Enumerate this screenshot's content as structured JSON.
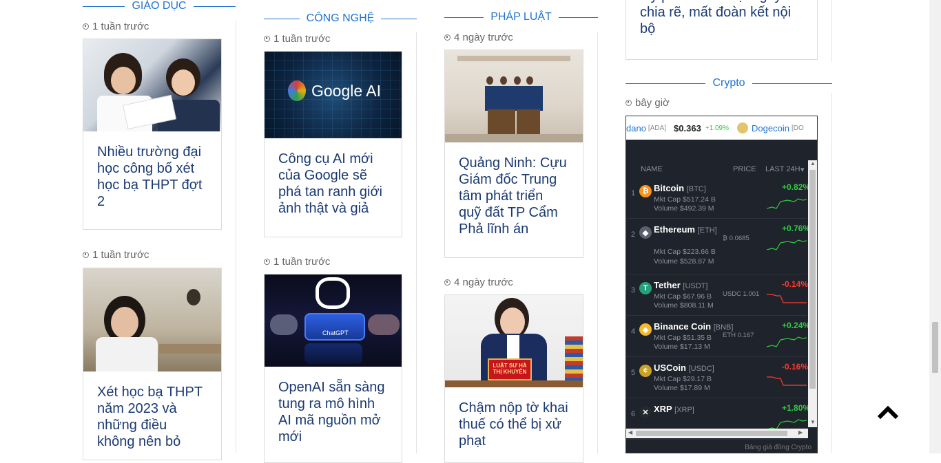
{
  "sections": {
    "giao_duc": {
      "label": "GIÁO DỤC",
      "articles": [
        {
          "time": "1 tuần trước",
          "title": "Nhiều trường đại học công bố xét học bạ THPT đợt 2"
        },
        {
          "time": "1 tuần trước",
          "title": "Xét học bạ THPT năm 2023 và những điều không nên bỏ"
        }
      ]
    },
    "cong_nghe": {
      "label": "CÔNG NGHỆ",
      "articles": [
        {
          "time": "1 tuần trước",
          "title": "Công cụ AI mới của Google sẽ phá tan ranh giới ảnh thật và giả",
          "image_text": "Google AI"
        },
        {
          "time": "1 tuần trước",
          "title": "OpenAI sẵn sàng tung ra mô hình AI mã nguồn mở mới",
          "image_text": "ChatGPT"
        }
      ]
    },
    "phap_luat": {
      "label": "PHÁP LUẬT",
      "articles": [
        {
          "time": "4 ngày trước",
          "title": "Quảng Ninh: Cựu Giám đốc Trung tâm phát triển quỹ đất TP Cẩm Phả lĩnh án"
        },
        {
          "time": "4 ngày trước",
          "title": "Chậm nộp tờ khai thuế có thể bị xử phạt",
          "image_text": "LUẬT SƯ HÀ THỊ KHUYÊN"
        }
      ]
    }
  },
  "prev_article": {
    "title": "lấy phiếu tín nhiệm gây chia rẽ, mất đoàn kết nội bộ"
  },
  "crypto": {
    "label": "Crypto",
    "time": "bây giờ",
    "ticker": [
      {
        "name": "dano",
        "sym": "[ADA]",
        "price": "$0.363",
        "change": "+1.09%"
      },
      {
        "name": "Dogecoin",
        "sym": "[DO"
      }
    ],
    "headers": {
      "name": "NAME",
      "price": "PRICE",
      "last": "LAST 24H"
    },
    "coins": [
      {
        "rank": "1",
        "name": "Bitcoin",
        "sym": "[BTC]",
        "mktcap": "Mkt Cap  $517.24 B",
        "volume": "Volume  $492.39 M",
        "price": "",
        "change": "+0.82%",
        "up": true,
        "icon": "₿",
        "color": "#f7931a"
      },
      {
        "rank": "2",
        "name": "Ethereum",
        "sym": "[ETH]",
        "mktcap": "Mkt Cap  $223.66 B",
        "volume": "Volume  $528.87 M",
        "price": "₿ 0.0685",
        "change": "+0.76%",
        "up": true,
        "icon": "◆",
        "color": "#5a6072"
      },
      {
        "rank": "3",
        "name": "Tether",
        "sym": "[USDT]",
        "mktcap": "Mkt Cap  $67.96 B",
        "volume": "Volume  $808.11 M",
        "price": "USDC 1.001",
        "change": "-0.14%",
        "up": false,
        "icon": "T",
        "color": "#26a17b"
      },
      {
        "rank": "4",
        "name": "Binance Coin",
        "sym": "[BNB]",
        "mktcap": "Mkt Cap  $51.35 B",
        "volume": "Volume  $17.13 M",
        "price": "ETH 0.167",
        "change": "+0.24%",
        "up": true,
        "icon": "◈",
        "color": "#f3ba2f"
      },
      {
        "rank": "5",
        "name": "USCoin",
        "sym": "[USDC]",
        "mktcap": "Mkt Cap  $29.17 B",
        "volume": "Volume  $17.89 M",
        "price": "",
        "change": "-0.16%",
        "up": false,
        "icon": "¢",
        "color": "#c9a227"
      },
      {
        "rank": "6",
        "name": "XRP",
        "sym": "[XRP]",
        "mktcap": "",
        "volume": "",
        "price": "",
        "change": "+1.80%",
        "up": true,
        "icon": "✕",
        "color": "#23292f"
      }
    ],
    "footer": "Bảng giá đồng Crypto",
    "colors": {
      "up": "#2ecc40",
      "down": "#ff3b30",
      "accent": "#1e73d2"
    }
  },
  "back_to_top_icon": "chevron-up-icon"
}
